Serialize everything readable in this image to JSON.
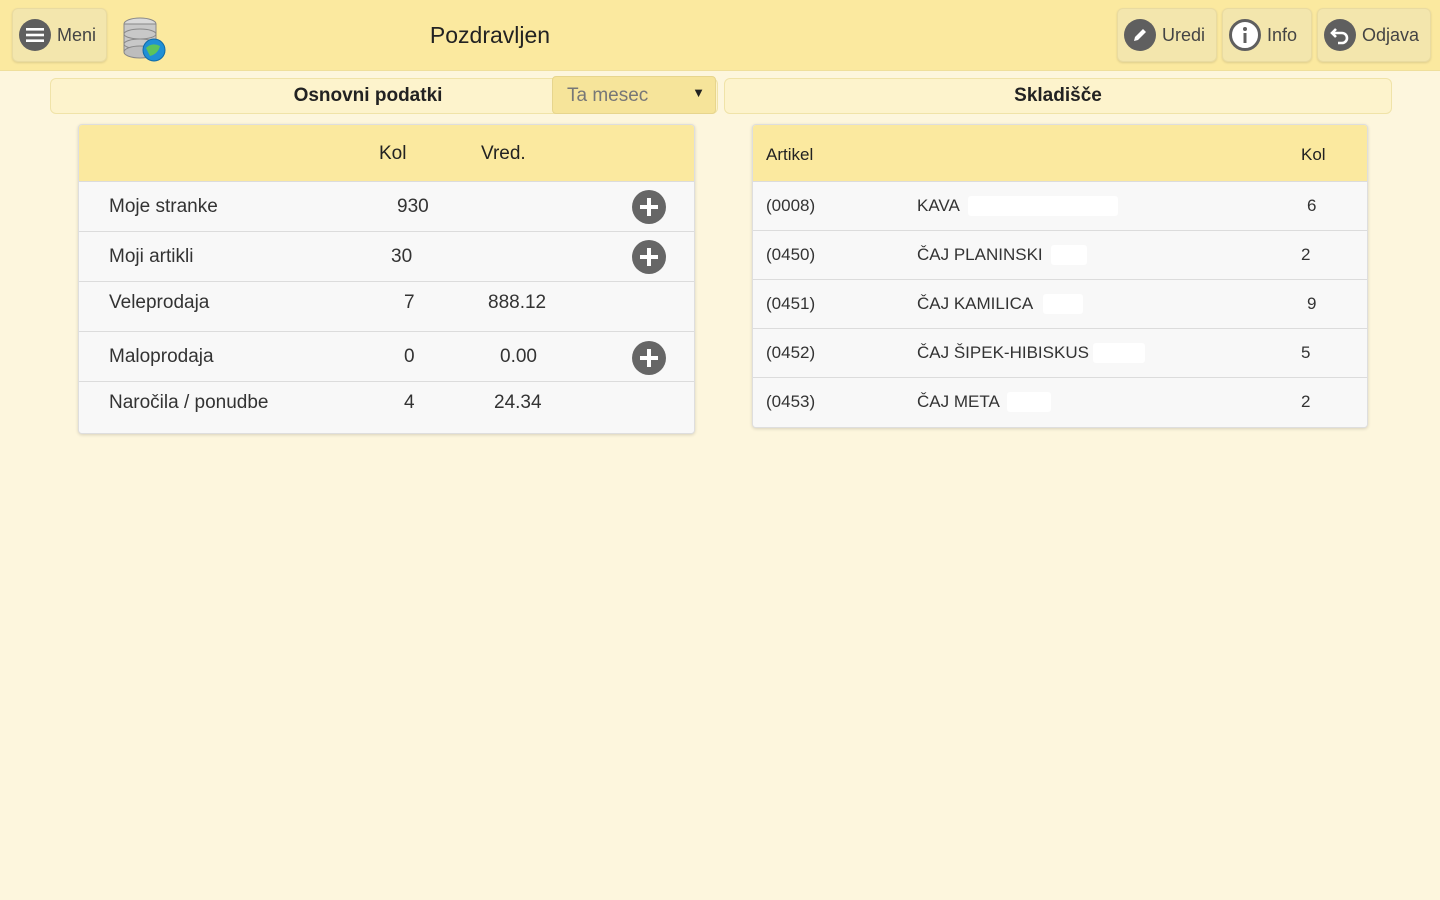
{
  "header": {
    "title": "Pozdravljen",
    "menu_label": "Meni",
    "edit_label": "Uredi",
    "info_label": "Info",
    "logout_label": "Odjava"
  },
  "basic": {
    "title": "Osnovni podatki",
    "period": "Ta mesec",
    "col_qty": "Kol",
    "col_value": "Vred.",
    "rows": [
      {
        "label": "Moje stranke",
        "qty": "930",
        "value": ""
      },
      {
        "label": "Moji artikli",
        "qty": "30",
        "value": ""
      },
      {
        "label": "Veleprodaja",
        "qty": "7",
        "value": "888.12"
      },
      {
        "label": "Maloprodaja",
        "qty": "0",
        "value": "0.00"
      },
      {
        "label": "Naročila / ponudbe",
        "qty": "4",
        "value": "24.34"
      }
    ]
  },
  "inventory": {
    "title": "Skladišče",
    "col_item": "Artikel",
    "col_qty": "Kol",
    "rows": [
      {
        "code": "(0008)",
        "name": "KAVA",
        "qty": "6"
      },
      {
        "code": "(0450)",
        "name": "ČAJ PLANINSKI",
        "qty": "2"
      },
      {
        "code": "(0451)",
        "name": "ČAJ KAMILICA",
        "qty": "9"
      },
      {
        "code": "(0452)",
        "name": "ČAJ ŠIPEK-HIBISKUS",
        "qty": "5"
      },
      {
        "code": "(0453)",
        "name": "ČAJ META",
        "qty": "2"
      }
    ]
  },
  "colors": {
    "header_bg": "#fbe99f",
    "page_bg": "#fdf6dd",
    "icon_gray": "#5f5f5f"
  }
}
